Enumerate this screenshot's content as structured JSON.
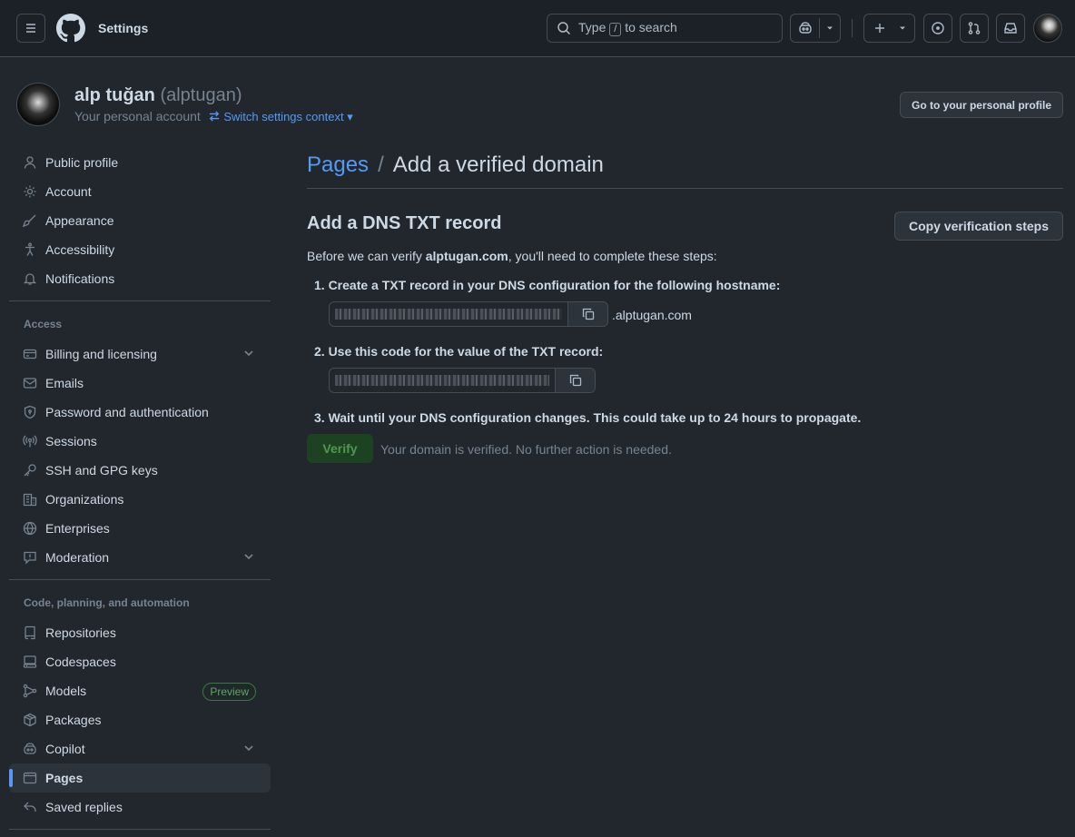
{
  "header": {
    "title": "Settings",
    "search_prefix": "Type",
    "search_key": "/",
    "search_suffix": "to search"
  },
  "profile": {
    "name": "alp tuğan",
    "login": "(alptugan)",
    "subtitle": "Your personal account",
    "switch_label": "Switch settings context",
    "go_profile_button": "Go to your personal profile"
  },
  "sidebar": {
    "top_items": [
      {
        "label": "Public profile",
        "icon": "person-icon"
      },
      {
        "label": "Account",
        "icon": "gear-icon"
      },
      {
        "label": "Appearance",
        "icon": "paintbrush-icon"
      },
      {
        "label": "Accessibility",
        "icon": "accessibility-icon"
      },
      {
        "label": "Notifications",
        "icon": "bell-icon"
      }
    ],
    "access_heading": "Access",
    "access_items": [
      {
        "label": "Billing and licensing",
        "icon": "credit-card-icon",
        "expandable": true
      },
      {
        "label": "Emails",
        "icon": "mail-icon"
      },
      {
        "label": "Password and authentication",
        "icon": "shield-lock-icon"
      },
      {
        "label": "Sessions",
        "icon": "broadcast-icon"
      },
      {
        "label": "SSH and GPG keys",
        "icon": "key-icon"
      },
      {
        "label": "Organizations",
        "icon": "organization-icon"
      },
      {
        "label": "Enterprises",
        "icon": "globe-icon"
      },
      {
        "label": "Moderation",
        "icon": "report-icon",
        "expandable": true
      }
    ],
    "code_heading": "Code, planning, and automation",
    "code_items": [
      {
        "label": "Repositories",
        "icon": "repo-icon"
      },
      {
        "label": "Codespaces",
        "icon": "codespaces-icon"
      },
      {
        "label": "Models",
        "icon": "workflow-icon",
        "badge": "Preview"
      },
      {
        "label": "Packages",
        "icon": "package-icon"
      },
      {
        "label": "Copilot",
        "icon": "copilot-icon",
        "expandable": true
      },
      {
        "label": "Pages",
        "icon": "browser-icon",
        "active": true
      },
      {
        "label": "Saved replies",
        "icon": "reply-icon"
      }
    ]
  },
  "main": {
    "breadcrumb_link": "Pages",
    "breadcrumb_sep": "/",
    "breadcrumb_current": "Add a verified domain",
    "section_title": "Add a DNS TXT record",
    "copy_steps_button": "Copy verification steps",
    "intro_prefix": "Before we can verify ",
    "intro_domain": "alptugan.com",
    "intro_suffix": ", you'll need to complete these steps:",
    "step1": "1. Create a TXT record in your DNS configuration for the following hostname:",
    "step1_suffix": ".alptugan.com",
    "step2": "2. Use this code for the value of the TXT record:",
    "step3": "3. Wait until your DNS configuration changes. This could take up to 24 hours to propagate.",
    "verify_button": "Verify",
    "verified_message": "Your domain is verified. No further action is needed."
  }
}
